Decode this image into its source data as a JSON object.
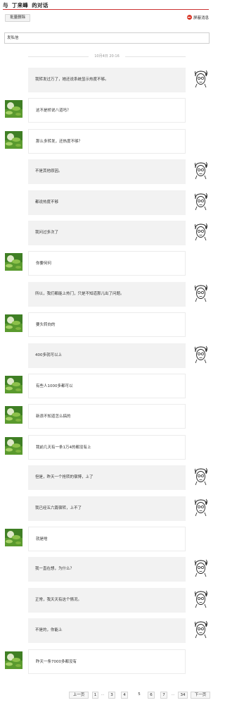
{
  "header": {
    "prefix": "与",
    "nickname": "丁来峰",
    "suffix": "的对话"
  },
  "toolbar": {
    "batch_delete_label": "批量删除",
    "mask_label": "屏蔽消息"
  },
  "compose": {
    "placeholder": "发私信"
  },
  "date_divider": "10月4日 20:16",
  "messages": [
    {
      "side": "sent",
      "text": "我转发过万了，她还说系统显示热度不够。"
    },
    {
      "side": "recv",
      "text": "这不是桥说八道吗？"
    },
    {
      "side": "recv",
      "text": "那么多转发，还热度不够？"
    },
    {
      "side": "sent",
      "text": "不是其他原因。"
    },
    {
      "side": "sent",
      "text": "都说热度不够"
    },
    {
      "side": "sent",
      "text": "我问过多次了"
    },
    {
      "side": "recv",
      "text": "你要何何"
    },
    {
      "side": "sent",
      "text": "所以，我们都能上热门，只是不知道那儿出了问题。"
    },
    {
      "side": "recv",
      "text": "要头转向的"
    },
    {
      "side": "sent",
      "text": "400多就可以上"
    },
    {
      "side": "recv",
      "text": "有些人1000多都可以"
    },
    {
      "side": "recv",
      "text": "新浪不知道怎么搞的"
    },
    {
      "side": "recv",
      "text": "我前几天有一条1万4的都没有上"
    },
    {
      "side": "sent",
      "text": "但是，昨天一个抢转的宿博，上了"
    },
    {
      "side": "sent",
      "text": "我已经五六篇宿转，上不了"
    },
    {
      "side": "recv",
      "text": "就是啥"
    },
    {
      "side": "sent",
      "text": "我一直在想，为什么？"
    },
    {
      "side": "sent",
      "text": "正常，我天天有这个情况。"
    },
    {
      "side": "sent",
      "text": "不是的，你能上"
    },
    {
      "side": "recv",
      "text": "昨天一条7000多都没有"
    }
  ],
  "pagination": {
    "prev_label": "上一页",
    "next_label": "下一页",
    "ellipsis": "...",
    "pages": [
      "1",
      "3",
      "4",
      "5",
      "6",
      "7",
      "34"
    ],
    "current": "5"
  },
  "colors": {
    "accent_red": "#cc3333",
    "sent_bubble": "#f2f2f2",
    "recv_avatar_green": "#4a8f2a"
  }
}
